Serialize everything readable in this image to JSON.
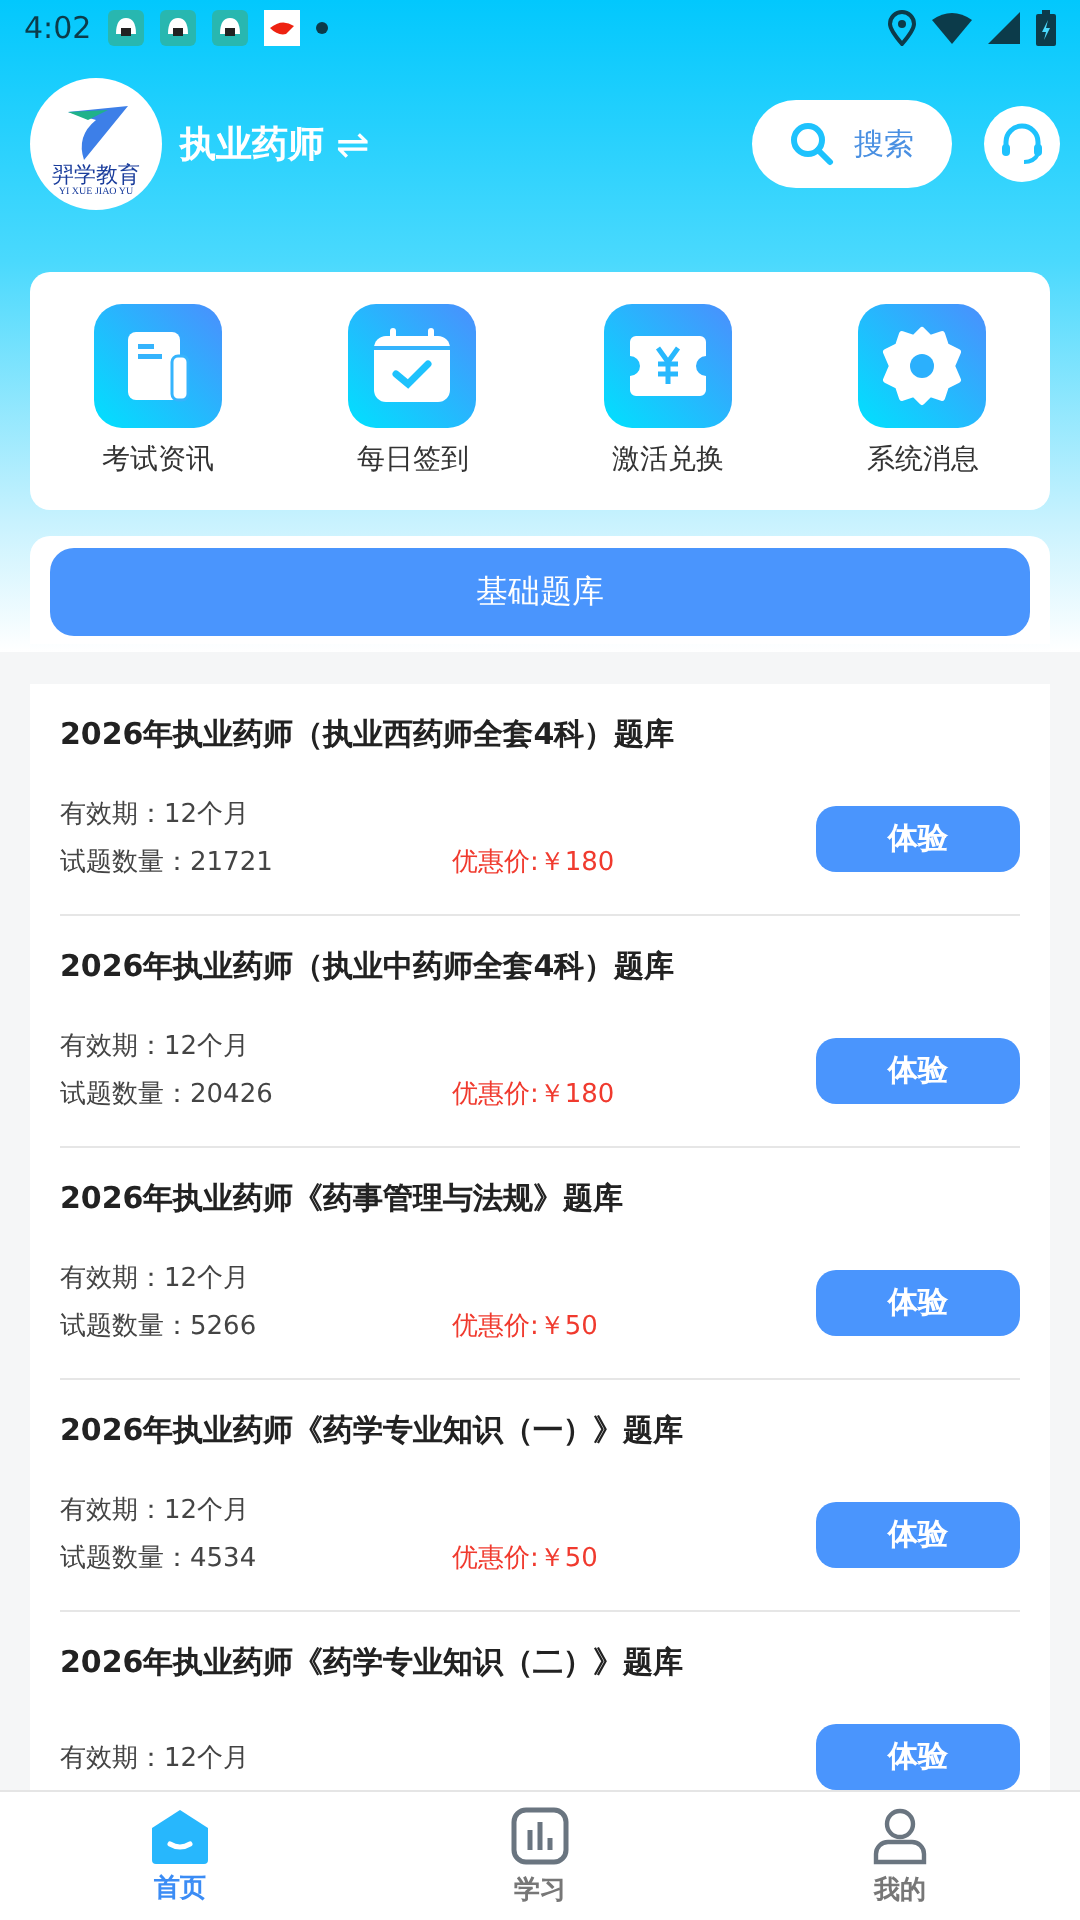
{
  "status_bar": {
    "time": "4:02"
  },
  "header": {
    "logo": {
      "name": "羿学教育",
      "pinyin": "YI XUE JIAO YU"
    },
    "title": "执业药师",
    "switch_icon": "⇌",
    "search": {
      "label": "搜索"
    }
  },
  "menu": [
    {
      "kind": "news",
      "label": "考试资讯"
    },
    {
      "kind": "checkin",
      "label": "每日签到"
    },
    {
      "kind": "redeem",
      "label": "激活兑换"
    },
    {
      "kind": "settings",
      "label": "系统消息"
    }
  ],
  "category_button": "基础题库",
  "banks": [
    {
      "title": "2026年执业药师（执业西药师全套4科）题库",
      "validity": "有效期：12个月",
      "count": "试题数量：21721",
      "price": "优惠价:￥180",
      "button": "体验"
    },
    {
      "title": "2026年执业药师（执业中药师全套4科）题库",
      "validity": "有效期：12个月",
      "count": "试题数量：20426",
      "price": "优惠价:￥180",
      "button": "体验"
    },
    {
      "title": "2026年执业药师《药事管理与法规》题库",
      "validity": "有效期：12个月",
      "count": "试题数量：5266",
      "price": "优惠价:￥50",
      "button": "体验"
    },
    {
      "title": "2026年执业药师《药学专业知识（一）》题库",
      "validity": "有效期：12个月",
      "count": "试题数量：4534",
      "price": "优惠价:￥50",
      "button": "体验"
    },
    {
      "title": "2026年执业药师《药学专业知识（二）》题库",
      "validity": "有效期：12个月",
      "button": "体验"
    }
  ],
  "bottom_nav": [
    {
      "kind": "home",
      "label": "首页",
      "selected": true
    },
    {
      "kind": "study",
      "label": "学习",
      "selected": false
    },
    {
      "kind": "profile",
      "label": "我的",
      "selected": false
    }
  ]
}
